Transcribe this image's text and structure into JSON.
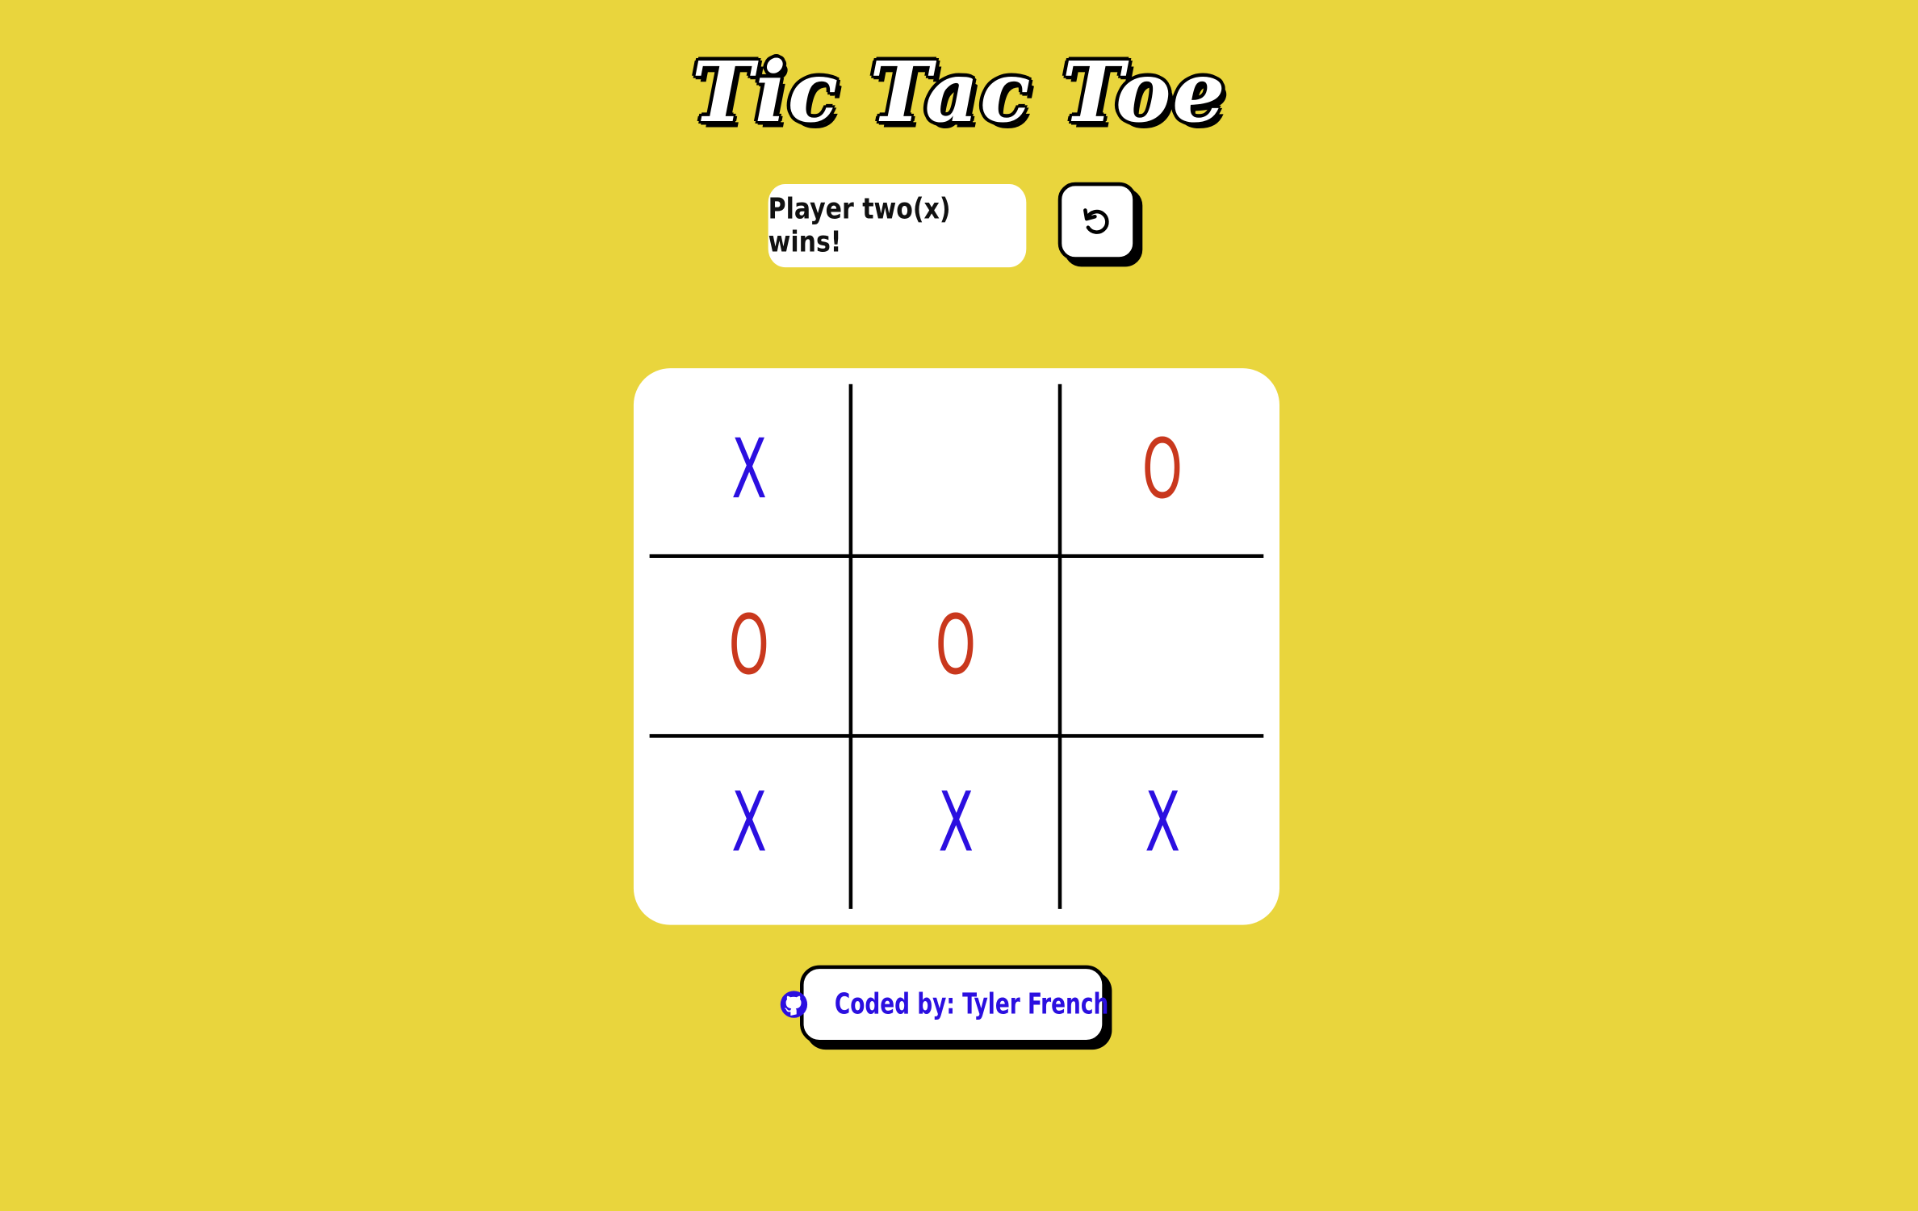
{
  "title": "Tic Tac Toe",
  "status_text": "Player two(x) wins!",
  "reset_icon": "refresh-icon",
  "board": [
    [
      "X",
      "",
      "O"
    ],
    [
      "O",
      "O",
      ""
    ],
    [
      "X",
      "X",
      "X"
    ]
  ],
  "credit": {
    "icon": "github-icon",
    "text": "Coded by: Tyler French"
  },
  "colors": {
    "background": "#e9d53d",
    "x_mark": "#2b0fe0",
    "o_mark": "#c9381d",
    "panel": "#ffffff"
  }
}
